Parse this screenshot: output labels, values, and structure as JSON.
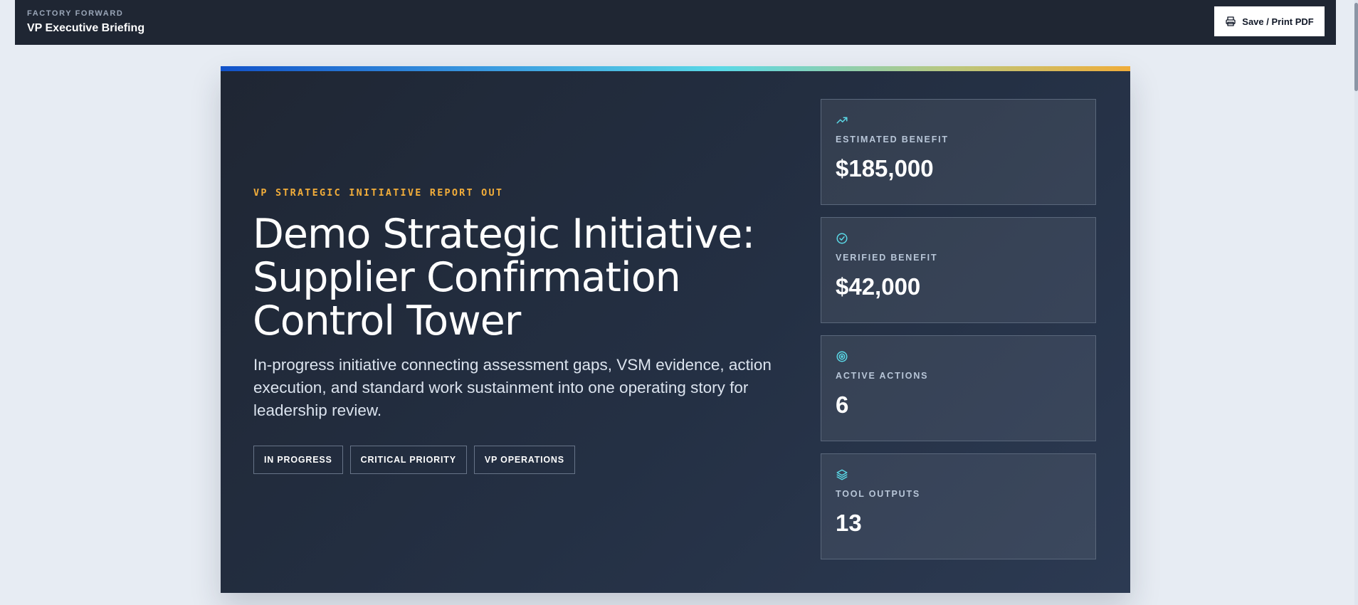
{
  "header": {
    "kicker": "FACTORY FORWARD",
    "title": "VP Executive Briefing",
    "print_label": "Save / Print PDF"
  },
  "hero": {
    "eyebrow": "VP STRATEGIC INITIATIVE REPORT OUT",
    "title": "Demo Strategic Initiative: Supplier Confirmation Control Tower",
    "description": "In-progress initiative connecting assessment gaps, VSM evidence, action execution, and standard work sustainment into one operating story for leadership review.",
    "tags": [
      "IN PROGRESS",
      "CRITICAL PRIORITY",
      "VP OPERATIONS"
    ]
  },
  "metrics": [
    {
      "icon": "trending-up-icon",
      "label": "ESTIMATED BENEFIT",
      "value": "$185,000"
    },
    {
      "icon": "check-circle-icon",
      "label": "VERIFIED BENEFIT",
      "value": "$42,000"
    },
    {
      "icon": "target-icon",
      "label": "ACTIVE ACTIONS",
      "value": "6"
    },
    {
      "icon": "layers-icon",
      "label": "TOOL OUTPUTS",
      "value": "13"
    }
  ],
  "colors": {
    "topbar": "#1f2633",
    "hero_background": "#243044",
    "eyebrow": "#f2ad3a",
    "icon_accent": "#5ad8e6",
    "page_background": "#e7ecf3"
  }
}
